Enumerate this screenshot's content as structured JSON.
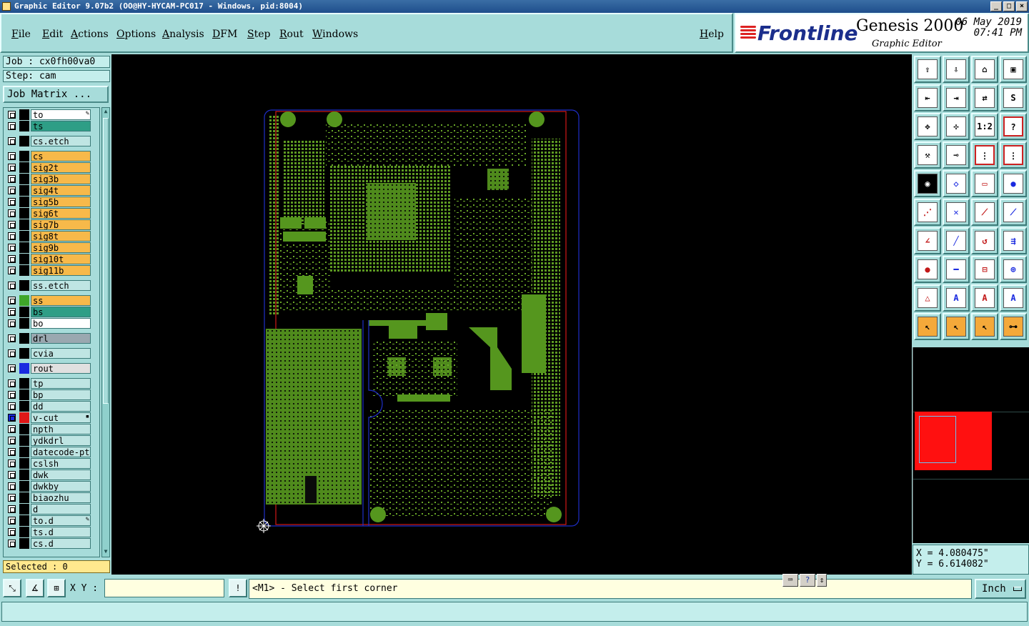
{
  "window": {
    "title": "Graphic Editor 9.07b2  (OO@HY-HYCAM-PC017 - Windows, pid:8004)"
  },
  "menu": [
    "File",
    "Edit",
    "Actions",
    "Options",
    "Analysis",
    "DFM",
    "Step",
    "Rout",
    "Windows"
  ],
  "help_label": "Help",
  "brand": {
    "logo": "Frontline",
    "product": "Genesis 2000",
    "subtitle": "Graphic Editor",
    "date": "06 May 2019",
    "time": "07:41 PM"
  },
  "job": {
    "job_label": "Job : cx0fh00va0",
    "step_label": "Step: cam",
    "matrix_button": "Job Matrix ..."
  },
  "layers": [
    {
      "name": "to",
      "color": "#ffffff",
      "mark": "pencil"
    },
    {
      "name": "ts",
      "color": "#2e9e86"
    },
    {
      "name": "cs.etch",
      "color": "#bfe5e3"
    },
    {
      "name": "cs",
      "color": "#f7b94a"
    },
    {
      "name": "sig2t",
      "color": "#f7b94a"
    },
    {
      "name": "sig3b",
      "color": "#f7b94a"
    },
    {
      "name": "sig4t",
      "color": "#f7b94a"
    },
    {
      "name": "sig5b",
      "color": "#f7b94a"
    },
    {
      "name": "sig6t",
      "color": "#f7b94a"
    },
    {
      "name": "sig7b",
      "color": "#f7b94a"
    },
    {
      "name": "sig8t",
      "color": "#f7b94a"
    },
    {
      "name": "sig9b",
      "color": "#f7b94a"
    },
    {
      "name": "sig10t",
      "color": "#f7b94a"
    },
    {
      "name": "sig11b",
      "color": "#f7b94a"
    },
    {
      "name": "ss.etch",
      "color": "#bfe5e3"
    },
    {
      "name": "ss",
      "color": "#f7b94a"
    },
    {
      "name": "bs",
      "color": "#2e9e86"
    },
    {
      "name": "bo",
      "color": "#ffffff"
    },
    {
      "name": "drl",
      "color": "#9aa8b0"
    },
    {
      "name": "cvia",
      "color": "#bfe5e3"
    },
    {
      "name": "rout",
      "color": "#e0e0e0"
    },
    {
      "name": "tp",
      "color": "#bfe5e3"
    },
    {
      "name": "bp",
      "color": "#bfe5e3"
    },
    {
      "name": "dd",
      "color": "#bfe5e3"
    },
    {
      "name": "v-cut",
      "color": "#bfe5e3",
      "mark": "dot"
    },
    {
      "name": "npth",
      "color": "#bfe5e3"
    },
    {
      "name": "ydkdrl",
      "color": "#bfe5e3"
    },
    {
      "name": "datecode-pt",
      "color": "#bfe5e3"
    },
    {
      "name": "cslsh",
      "color": "#bfe5e3"
    },
    {
      "name": "dwk",
      "color": "#bfe5e3"
    },
    {
      "name": "dwkby",
      "color": "#bfe5e3"
    },
    {
      "name": "biaozhu",
      "color": "#bfe5e3"
    },
    {
      "name": "d",
      "color": "#bfe5e3"
    },
    {
      "name": "to.d",
      "color": "#bfe5e3",
      "mark": "pencil"
    },
    {
      "name": "ts.d",
      "color": "#bfe5e3"
    },
    {
      "name": "cs.d",
      "color": "#bfe5e3"
    }
  ],
  "selected": "Selected : 0",
  "coords": {
    "x": "X =  4.080475\"",
    "y": "Y =  6.614082\""
  },
  "bottom": {
    "xy_label": "X Y :",
    "xy_value": "",
    "prompt": "<M1> - Select first corner",
    "unit": "Inch"
  },
  "tool_icons": [
    "open-icon",
    "save-icon",
    "home-icon",
    "window-icon",
    "import-icon",
    "export-icon",
    "swap-icon",
    "flip-icon",
    "zoom-fit-icon",
    "zoom-center-icon",
    "scale-icon",
    "help-icon",
    "tools-icon",
    "probe-icon",
    "layers-icon",
    "layers-red-icon",
    "snapshot-icon",
    "clip-icon",
    "ruler-icon",
    "pad-icon",
    "connect-icon",
    "cross-icon",
    "line-icon",
    "line-dot-icon",
    "angle-icon",
    "diagonal-icon",
    "arc-icon",
    "flag-icon",
    "align-icon",
    "minus-icon",
    "measure-icon",
    "group-icon",
    "triangle-icon",
    "tri-a-icon",
    "tri-a2-icon",
    "tri-a3-icon",
    "pointer-icon",
    "pointer-b-icon",
    "pointer-c-icon",
    "route-icon"
  ]
}
